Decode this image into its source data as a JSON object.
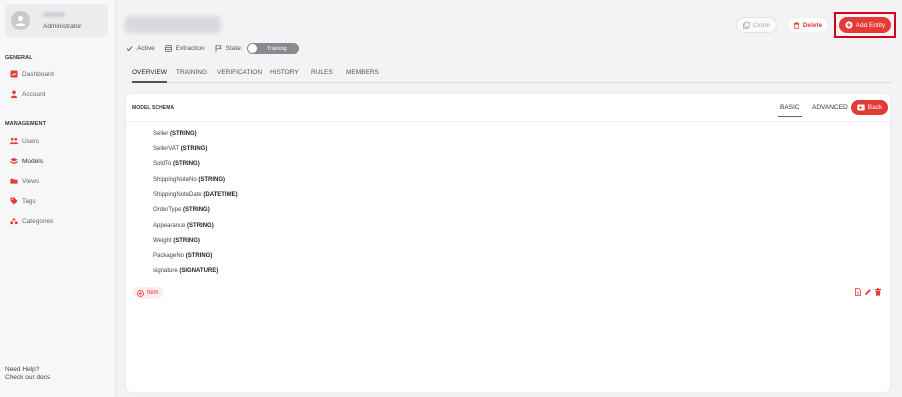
{
  "sidebar": {
    "user_role": "Administrator",
    "general_title": "GENERAL",
    "general_items": [
      {
        "label": "Dashboard",
        "icon": "dashboard-icon"
      },
      {
        "label": "Account",
        "icon": "account-icon"
      }
    ],
    "management_title": "MANAGEMENT",
    "management_items": [
      {
        "label": "Users",
        "icon": "users-icon"
      },
      {
        "label": "Models",
        "icon": "models-icon"
      },
      {
        "label": "Views",
        "icon": "folder-icon"
      },
      {
        "label": "Tags",
        "icon": "tag-icon"
      },
      {
        "label": "Categories",
        "icon": "categories-icon"
      }
    ],
    "help_title": "Need Help?",
    "help_link": "Check our docs"
  },
  "header": {
    "clone_label": "Clone",
    "delete_label": "Delete",
    "add_entity_label": "Add Entity",
    "status_active": "Active",
    "status_extraction": "Extraction",
    "state_label": "State:",
    "state_value": "Training"
  },
  "tabs": [
    "OVERVIEW",
    "TRAINING",
    "VERIFICATION",
    "HISTORY",
    "RULES",
    "MEMBERS"
  ],
  "card": {
    "title": "MODEL SCHEMA",
    "mode_basic": "BASIC",
    "mode_advanced": "ADVANCED",
    "back_label": "Back",
    "fields": [
      {
        "name": "Seller",
        "type": "(STRING)"
      },
      {
        "name": "SellerVAT",
        "type": "(STRING)"
      },
      {
        "name": "SoldTo",
        "type": "(STRING)"
      },
      {
        "name": "ShippingNoteNo",
        "type": "(STRING)"
      },
      {
        "name": "ShippingNoteDate",
        "type": "(DATETIME)"
      },
      {
        "name": "OrderType",
        "type": "(STRING)"
      },
      {
        "name": "Appearance",
        "type": "(STRING)"
      },
      {
        "name": "Weight",
        "type": "(STRING)"
      },
      {
        "name": "PackageNo",
        "type": "(STRING)"
      },
      {
        "name": "signature",
        "type": "(SIGNATURE)"
      }
    ],
    "item_label": "Item"
  },
  "colors": {
    "accent": "#e53935",
    "highlight": "#d0021b"
  }
}
